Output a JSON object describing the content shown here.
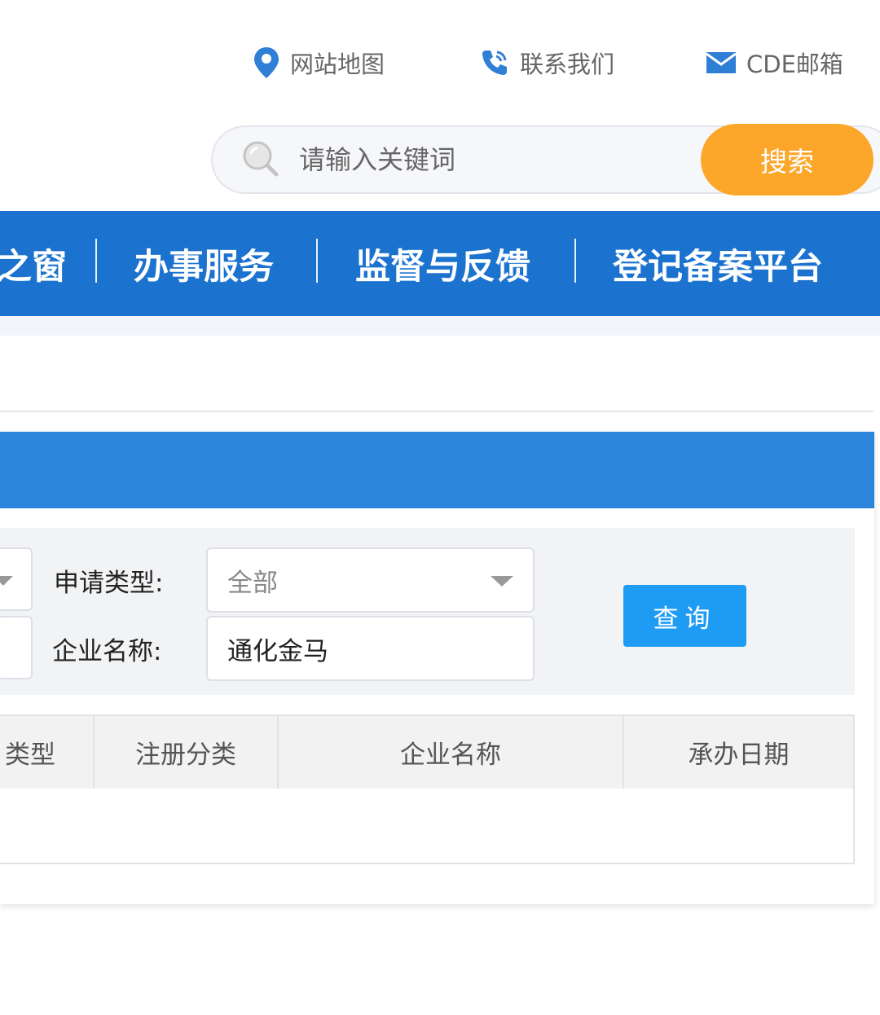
{
  "top_links": {
    "site_map": "网站地图",
    "contact_us": "联系我们",
    "cde_mail": "CDE邮箱"
  },
  "search": {
    "placeholder": "请输入关键词",
    "button_label": "搜索"
  },
  "nav": {
    "items": [
      {
        "label": "之窗"
      },
      {
        "label": "办事服务"
      },
      {
        "label": "监督与反馈"
      },
      {
        "label": "登记备案平台"
      }
    ]
  },
  "form": {
    "apply_type_label": "申请类型:",
    "apply_type_value": "全部",
    "company_name_label": "企业名称:",
    "company_name_value": "通化金马",
    "query_button": "查询"
  },
  "table": {
    "columns": [
      "类型",
      "注册分类",
      "企业名称",
      "承办日期"
    ]
  },
  "colors": {
    "nav_blue": "#1c73cf",
    "panel_header_blue": "#2b86db",
    "search_orange": "#fca62a",
    "query_blue": "#1e9cf3"
  }
}
